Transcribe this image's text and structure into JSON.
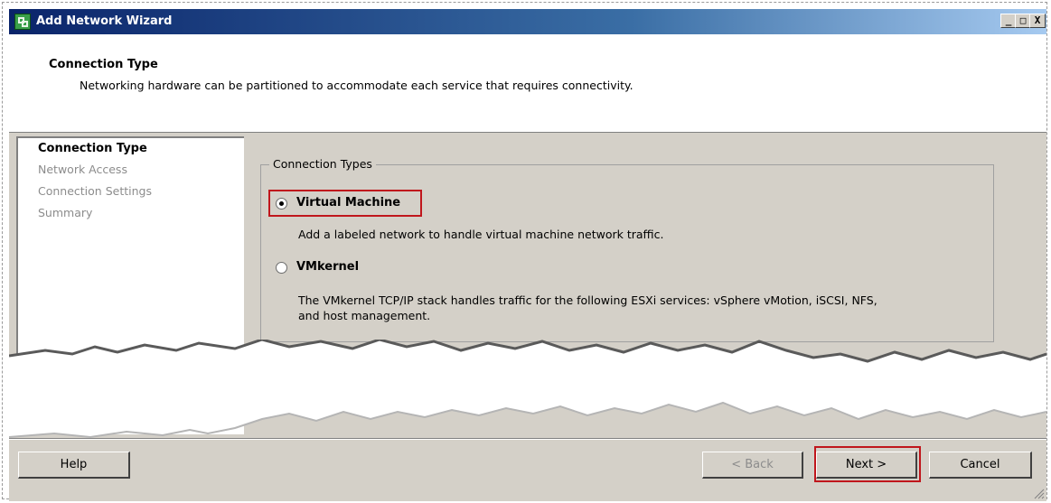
{
  "window": {
    "title": "Add Network Wizard",
    "controls": [
      "_",
      "□",
      "X"
    ]
  },
  "header": {
    "title": "Connection Type",
    "description": "Networking hardware can be partitioned to accommodate each service that requires connectivity."
  },
  "steps": [
    {
      "label": "Connection Type",
      "active": true
    },
    {
      "label": "Network Access",
      "active": false
    },
    {
      "label": "Connection Settings",
      "active": false
    },
    {
      "label": "Summary",
      "active": false
    }
  ],
  "connection_types": {
    "legend": "Connection Types",
    "options": [
      {
        "label": "Virtual Machine",
        "selected": true,
        "description": "Add a labeled network to handle virtual machine network traffic."
      },
      {
        "label": "VMkernel",
        "selected": false,
        "description_line1": "The VMkernel TCP/IP stack handles traffic for the following ESXi services: vSphere vMotion, iSCSI, NFS,",
        "description_line2": "and host management."
      }
    ]
  },
  "buttons": {
    "help": "Help",
    "back": "< Back",
    "next": "Next >",
    "cancel": "Cancel"
  },
  "colors": {
    "highlight": "#c0161c",
    "window_bg": "#d4d0c8",
    "title_bar": "#0a246a"
  },
  "icons": [
    "app-icon",
    "minimize-icon",
    "maximize-icon",
    "close-icon",
    "resize-grip-icon"
  ]
}
